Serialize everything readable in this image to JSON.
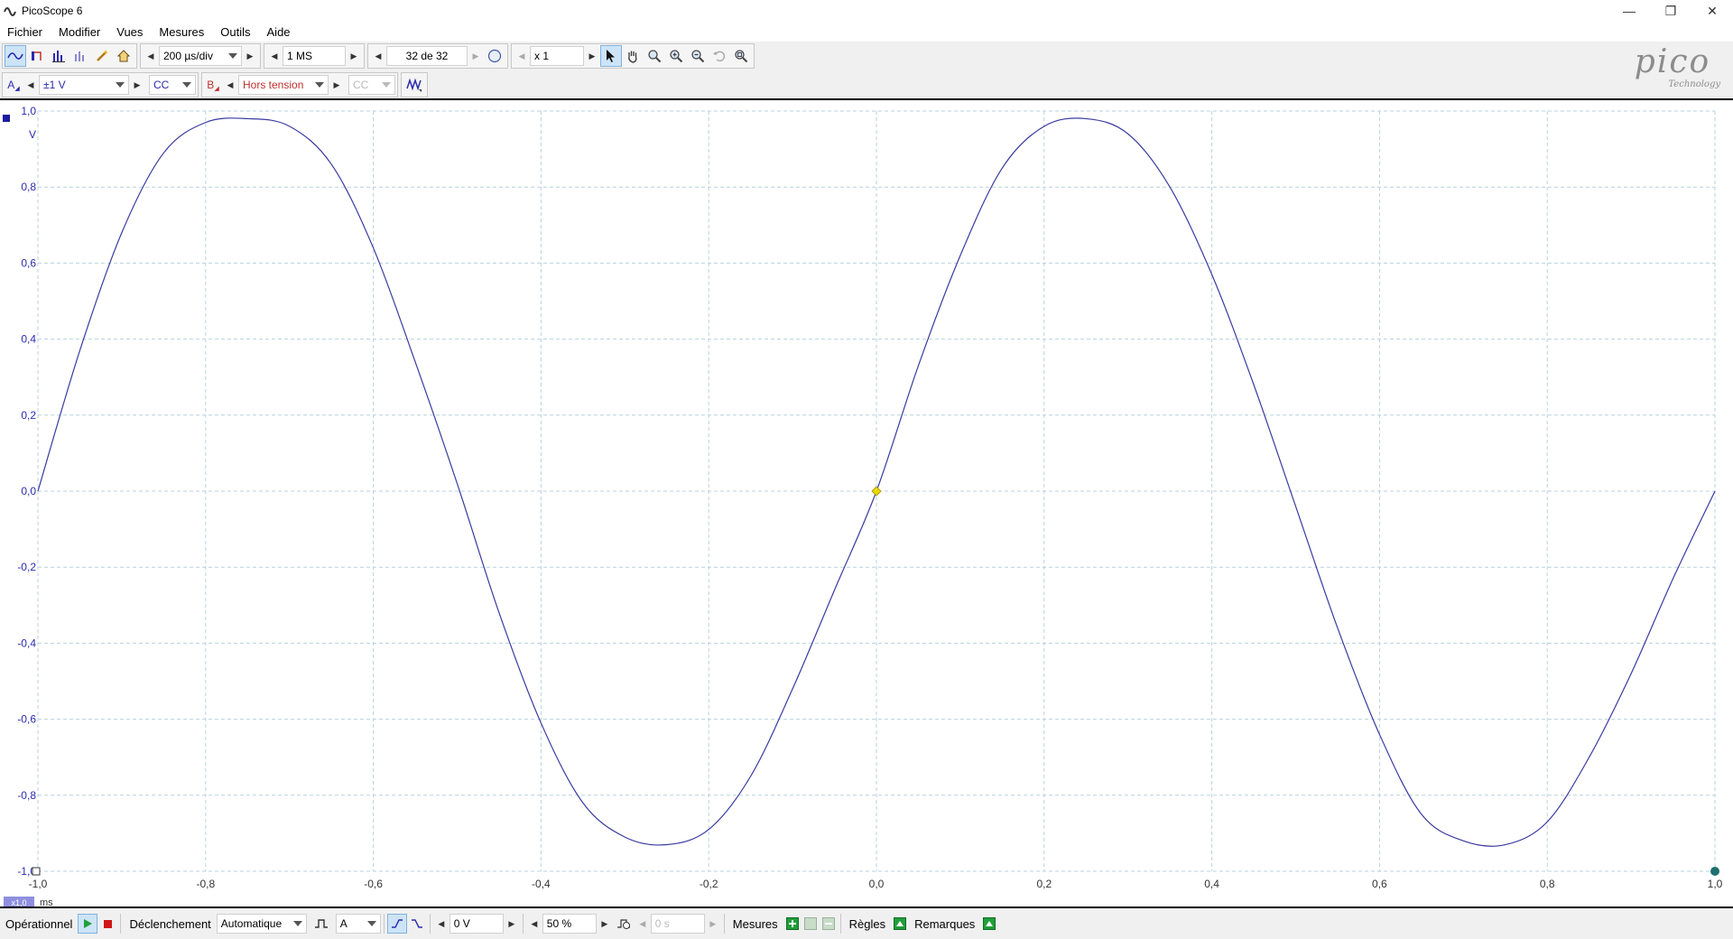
{
  "window": {
    "title": "PicoScope 6"
  },
  "menu": [
    "Fichier",
    "Modifier",
    "Vues",
    "Mesures",
    "Outils",
    "Aide"
  ],
  "toolbar": {
    "timebase": "200 µs/div",
    "samples": "1 MS",
    "buffer": "32 de 32",
    "zoom": "x 1"
  },
  "channels": {
    "a": {
      "label": "A",
      "range": "±1 V",
      "coupling": "CC"
    },
    "b": {
      "label": "B",
      "range": "Hors tension",
      "coupling": "CC"
    }
  },
  "logo": {
    "brand": "pico",
    "sub": "Technology"
  },
  "chart_data": {
    "type": "line",
    "xlabel": "ms",
    "ylabel": "V",
    "xlim": [
      -1.0,
      1.0
    ],
    "ylim": [
      -1.0,
      1.0
    ],
    "x_ticks": [
      "-1,0",
      "-0,8",
      "-0,6",
      "-0,4",
      "-0,2",
      "0,0",
      "0,2",
      "0,4",
      "0,6",
      "0,8",
      "1,0"
    ],
    "y_ticks": [
      "1,0",
      "0,8",
      "0,6",
      "0,4",
      "0,2",
      "0,0",
      "-0,2",
      "-0,4",
      "-0,6",
      "-0,8",
      "-1,0"
    ],
    "grid": true,
    "x_scale_badge": "x1,0",
    "series": [
      {
        "color": "#3a3aa0",
        "x": [
          -1.0,
          -0.95,
          -0.9,
          -0.85,
          -0.8,
          -0.75,
          -0.7,
          -0.65,
          -0.6,
          -0.55,
          -0.5,
          -0.45,
          -0.4,
          -0.35,
          -0.3,
          -0.25,
          -0.2,
          -0.15,
          -0.1,
          -0.05,
          0.0,
          0.05,
          0.1,
          0.15,
          0.2,
          0.25,
          0.3,
          0.35,
          0.4,
          0.45,
          0.5,
          0.55,
          0.6,
          0.65,
          0.7,
          0.75,
          0.8,
          0.85,
          0.9,
          0.95,
          1.0
        ],
        "y": [
          0.0,
          0.37,
          0.68,
          0.89,
          0.97,
          0.98,
          0.96,
          0.86,
          0.64,
          0.34,
          0.02,
          -0.32,
          -0.61,
          -0.82,
          -0.91,
          -0.93,
          -0.89,
          -0.75,
          -0.52,
          -0.26,
          0.0,
          0.33,
          0.62,
          0.85,
          0.96,
          0.98,
          0.94,
          0.8,
          0.57,
          0.28,
          -0.04,
          -0.36,
          -0.64,
          -0.85,
          -0.92,
          -0.93,
          -0.87,
          -0.7,
          -0.48,
          -0.23,
          0.0
        ]
      }
    ],
    "trigger_marker": {
      "x": 0.0,
      "y": 0.0,
      "color": "#e8d800"
    }
  },
  "status": {
    "run_state": "Opérationnel",
    "trigger_label": "Déclenchement",
    "trigger_mode": "Automatique",
    "trigger_source": "A",
    "threshold": "0 V",
    "pretrigger": "50 %",
    "delay": "0 s",
    "measures": "Mesures",
    "rulers": "Règles",
    "notes": "Remarques"
  }
}
